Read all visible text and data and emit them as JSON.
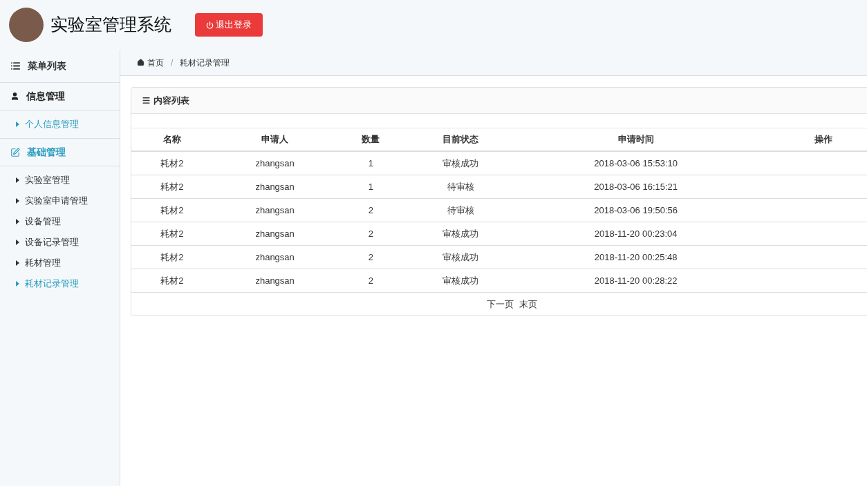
{
  "header": {
    "title": "实验室管理系统",
    "logout_button": "退出登录"
  },
  "sidebar": {
    "title": "菜单列表",
    "groups": [
      {
        "label": "信息管理",
        "kind": "user",
        "selected": false,
        "items": [
          {
            "label": "个人信息管理",
            "selected": true
          }
        ]
      },
      {
        "label": "基础管理",
        "kind": "edit",
        "selected": true,
        "items": [
          {
            "label": "实验室管理",
            "selected": false
          },
          {
            "label": "实验室申请管理",
            "selected": false
          },
          {
            "label": "设备管理",
            "selected": false
          },
          {
            "label": "设备记录管理",
            "selected": false
          },
          {
            "label": "耗材管理",
            "selected": false
          },
          {
            "label": "耗材记录管理",
            "selected": true
          }
        ]
      }
    ]
  },
  "breadcrumb": {
    "separator": "/",
    "items": [
      "首页",
      "耗材记录管理"
    ]
  },
  "panel": {
    "title": "内容列表"
  },
  "table": {
    "columns": [
      "名称",
      "申请人",
      "数量",
      "目前状态",
      "申请时间",
      "操作"
    ],
    "rows": [
      [
        "耗材2",
        "zhangsan",
        "1",
        "审核成功",
        "2018-03-06 15:53:10",
        ""
      ],
      [
        "耗材2",
        "zhangsan",
        "1",
        "待审核",
        "2018-03-06 16:15:21",
        ""
      ],
      [
        "耗材2",
        "zhangsan",
        "2",
        "待审核",
        "2018-03-06 19:50:56",
        ""
      ],
      [
        "耗材2",
        "zhangsan",
        "2",
        "审核成功",
        "2018-11-20 00:23:04",
        ""
      ],
      [
        "耗材2",
        "zhangsan",
        "2",
        "审核成功",
        "2018-11-20 00:25:48",
        ""
      ],
      [
        "耗材2",
        "zhangsan",
        "2",
        "审核成功",
        "2018-11-20 00:28:22",
        ""
      ]
    ]
  },
  "pagination": [
    "下一页",
    "末页"
  ]
}
